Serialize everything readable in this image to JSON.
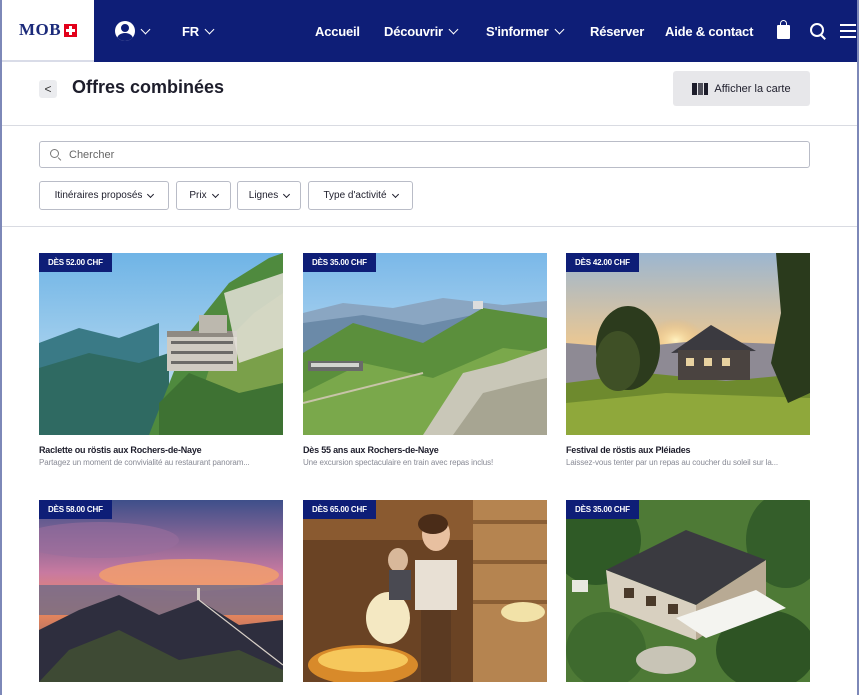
{
  "nav": {
    "logo": "MOB",
    "language": "FR",
    "items": [
      "Accueil",
      "Découvrir",
      "S'informer",
      "Réserver",
      "Aide & contact"
    ]
  },
  "header": {
    "title": "Offres combinées",
    "back_label": "<",
    "map_button": "Afficher la carte"
  },
  "search": {
    "placeholder": "Chercher"
  },
  "filters": [
    "Itinéraires proposés",
    "Prix",
    "Lignes",
    "Type d'activité"
  ],
  "cards": [
    {
      "price": "DÈS 52.00 CHF",
      "title": "Raclette ou röstis aux Rochers-de-Naye",
      "description": "Partagez un moment de convivialité au restaurant panoram..."
    },
    {
      "price": "DÈS 35.00 CHF",
      "title": "Dès 55 ans aux Rochers-de-Naye",
      "description": "Une excursion spectaculaire en train avec repas inclus!"
    },
    {
      "price": "DÈS 42.00 CHF",
      "title": "Festival de röstis aux Pléiades",
      "description": "Laissez-vous tenter par un repas au coucher du soleil sur la..."
    },
    {
      "price": "DÈS 58.00 CHF",
      "title": "",
      "description": ""
    },
    {
      "price": "DÈS 65.00 CHF",
      "title": "",
      "description": ""
    },
    {
      "price": "DÈS 35.00 CHF",
      "title": "",
      "description": ""
    }
  ]
}
